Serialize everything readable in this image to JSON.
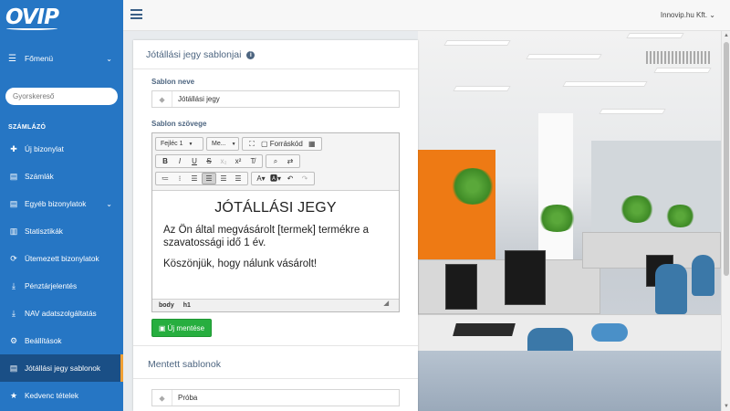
{
  "app": {
    "logo": "OVIP",
    "company": "Innovip.hu Kft."
  },
  "sidebar": {
    "main_menu": "Főmenü",
    "search_placeholder": "Gyorskereső",
    "section": "SZÁMLÁZÓ",
    "items": [
      {
        "label": "Új bizonylat",
        "icon": "plus-icon"
      },
      {
        "label": "Számlák",
        "icon": "document-icon"
      },
      {
        "label": "Egyéb bizonylatok",
        "icon": "document-icon",
        "has_submenu": true
      },
      {
        "label": "Statisztikák",
        "icon": "bar-chart-icon"
      },
      {
        "label": "Ütemezett bizonylatok",
        "icon": "refresh-icon"
      },
      {
        "label": "Pénztárjelentés",
        "icon": "download-icon"
      },
      {
        "label": "NAV adatszolgáltatás",
        "icon": "download-icon"
      },
      {
        "label": "Beállítások",
        "icon": "gear-icon"
      },
      {
        "label": "Jótállási jegy sablonok",
        "icon": "document-icon",
        "active": true
      },
      {
        "label": "Kedvenc tételek",
        "icon": "star-icon"
      }
    ]
  },
  "panel": {
    "title": "Jótállási jegy sablonjai",
    "name_label": "Sablon neve",
    "name_value": "Jótállási jegy",
    "text_label": "Sablon szövege",
    "toolbar": {
      "format_combo": "Fejléc 1",
      "size_combo": "Me...",
      "source_label": "Forráskód"
    },
    "content": {
      "heading": "JÓTÁLLÁSI JEGY",
      "paragraph1": "Az Ön által megvásárolt [termek] termékre a szavatossági idő 1 év.",
      "paragraph2": "Köszönjük, hogy nálunk vásárolt!"
    },
    "path": [
      "body",
      "h1"
    ],
    "new_button": "Új mentése",
    "saved_title": "Mentett sablonok",
    "saved_items": [
      "Próba"
    ]
  },
  "colors": {
    "sidebar": "#2676c4",
    "active_item": "#1a4f86",
    "active_accent": "#f0a035",
    "button_green": "#27ae3f",
    "title_text": "#4d6580"
  }
}
